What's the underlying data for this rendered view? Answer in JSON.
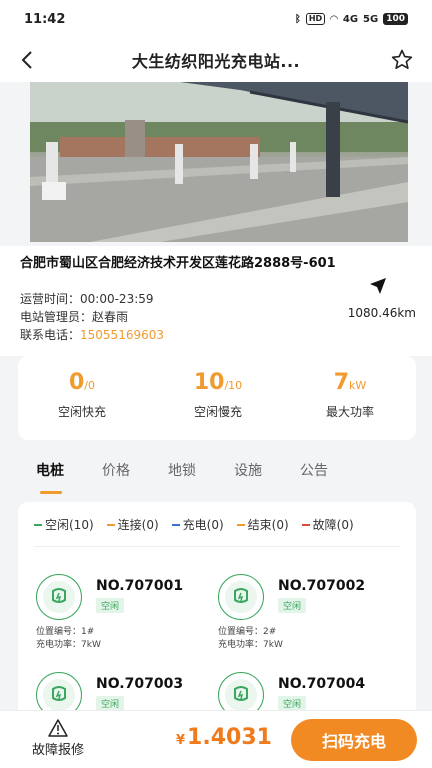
{
  "status_bar": {
    "time": "11:42",
    "hd": "HD",
    "sig1": "4G",
    "sig2": "5G",
    "battery": "100"
  },
  "nav": {
    "title": "大生纺织阳光充电站..."
  },
  "station": {
    "address": "合肥市蜀山区合肥经济技术开发区莲花路2888号-601",
    "hours_label": "运营时间：",
    "hours": "00:00-23:59",
    "manager_label": "电站管理员：",
    "manager": "赵春雨",
    "phone_label": "联系电话：",
    "phone": "15055169603",
    "distance": "1080.46km"
  },
  "stats": [
    {
      "big": "0",
      "unit": "/0",
      "label": "空闲快充"
    },
    {
      "big": "10",
      "unit": "/10",
      "label": "空闲慢充"
    },
    {
      "big": "7",
      "unit": "kW",
      "label": "最大功率"
    }
  ],
  "tabs": [
    "电桩",
    "价格",
    "地锁",
    "设施",
    "公告"
  ],
  "legend": [
    {
      "label": "空闲(10)",
      "color": "#3aa75e"
    },
    {
      "label": "连接(0)",
      "color": "#f19a2e"
    },
    {
      "label": "充电(0)",
      "color": "#3a6fd8"
    },
    {
      "label": "结束(0)",
      "color": "#f19a2e"
    },
    {
      "label": "故障(0)",
      "color": "#e24b3b"
    }
  ],
  "piles": [
    {
      "no": "NO.707001",
      "status": "空闲",
      "pos": "位置编号：1#",
      "power": "充电功率：7kW"
    },
    {
      "no": "NO.707002",
      "status": "空闲",
      "pos": "位置编号：2#",
      "power": "充电功率：7kW"
    },
    {
      "no": "NO.707003",
      "status": "空闲"
    },
    {
      "no": "NO.707004",
      "status": "空闲"
    }
  ],
  "bottom": {
    "report_label": "故障报修",
    "price_symbol": "¥",
    "price": "1.4031",
    "scan_label": "扫码充电"
  },
  "colors": {
    "accent": "#f19a2e",
    "idle": "#3aa75e",
    "button": "#f28a24"
  }
}
